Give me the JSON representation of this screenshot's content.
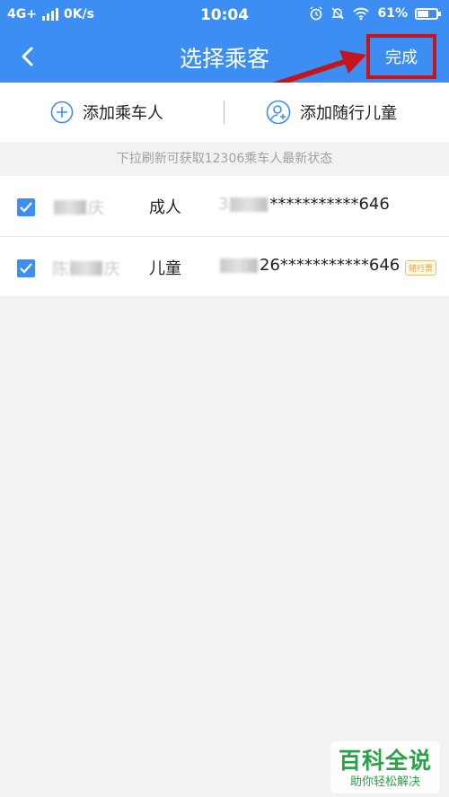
{
  "status_bar": {
    "network": "4G+",
    "speed": "0K/s",
    "time": "10:04",
    "battery": "61%",
    "battery_level": 0.61
  },
  "nav": {
    "title": "选择乘客",
    "done_label": "完成",
    "back_icon": "chevron-left-icon"
  },
  "actions": {
    "add_passenger": "添加乘车人",
    "add_child": "添加随行儿童"
  },
  "hint": "下拉刷新可获取12306乘车人最新状态",
  "passengers": [
    {
      "name_prefix": "",
      "name_suffix": "庆",
      "type": "成人",
      "id_prefix": "3",
      "id_suffix": "***********646",
      "checked": true,
      "badge": ""
    },
    {
      "name_prefix": "陈",
      "name_suffix": "庆",
      "type": "儿童",
      "id_prefix": "",
      "id_suffix": "26***********646",
      "checked": true,
      "badge": "随行票"
    }
  ],
  "watermark": {
    "main": "百科全说",
    "sub": "助你轻松解决"
  },
  "colors": {
    "primary": "#3d8ef2",
    "annotation_red": "#c4151c",
    "watermark_green": "#2aa147"
  }
}
